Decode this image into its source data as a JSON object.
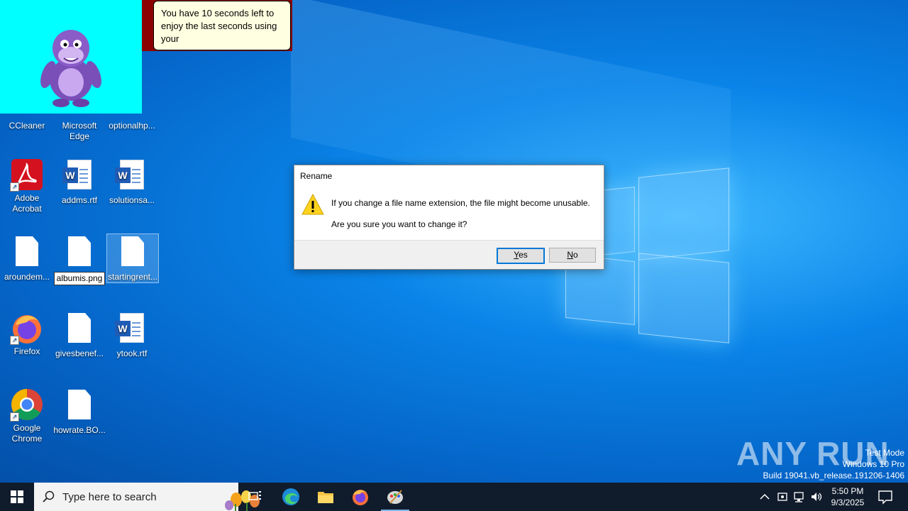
{
  "desktop_icons": {
    "ccleaner": "CCleaner",
    "edge": "Microsoft Edge",
    "optionalhp": "optionalhp...",
    "adobe": "Adobe Acrobat",
    "addms": "addms.rtf",
    "solutionsa": "solutionsa...",
    "aroundem": "aroundem...",
    "albumis_rename": "albumis.png",
    "startingrent": "startingrent...",
    "firefox": "Firefox",
    "givesbenef": "givesbenef...",
    "ytook": "ytook.rtf",
    "chrome": "Google Chrome",
    "howrate": "howrate.BO..."
  },
  "bonzi": {
    "bubble_text": "You have 10 seconds left to enjoy the last seconds using your"
  },
  "dialog": {
    "title": "Rename",
    "message1": "If you change a file name extension, the file might become unusable.",
    "message2": "Are you sure you want to change it?",
    "yes_label": "Yes",
    "no_label": "No"
  },
  "watermark": {
    "line1": "Test Mode",
    "line2": "Windows 10 Pro",
    "line3": "Build 19041.vb_release.191206-1406",
    "brand": "ANY RUN"
  },
  "taskbar": {
    "search_placeholder": "Type here to search",
    "time": "5:50 PM",
    "date": "9/3/2025"
  },
  "colors": {
    "accent": "#0078d7",
    "taskbar": "#101c2c",
    "bonzi_bg": "#00ffff"
  }
}
